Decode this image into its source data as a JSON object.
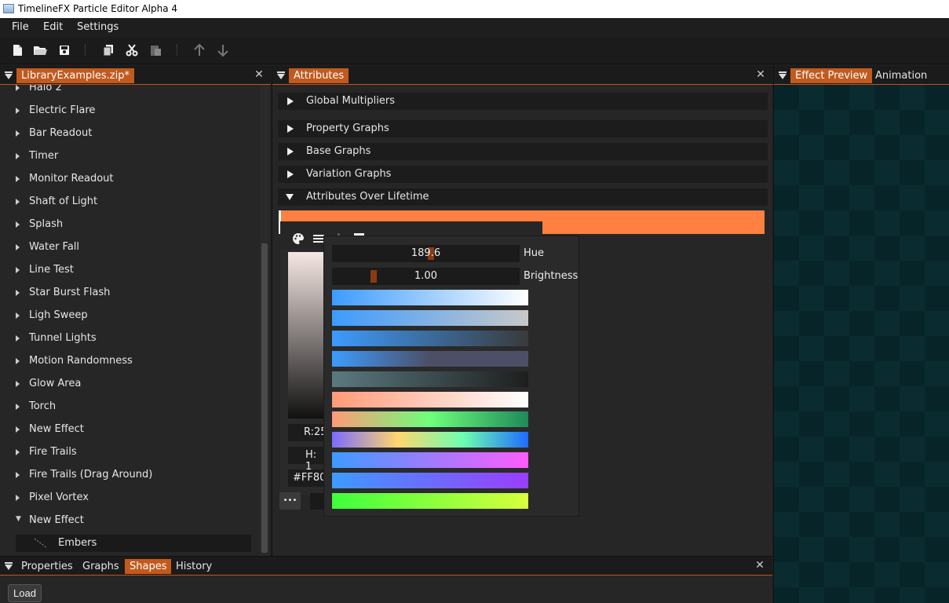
{
  "window": {
    "title": "TimelineFX Particle Editor Alpha 4"
  },
  "menu": {
    "items": [
      "File",
      "Edit",
      "Settings"
    ]
  },
  "library": {
    "tab": "LibraryExamples.zip*",
    "items": [
      {
        "label": "Halo 2",
        "expanded": false
      },
      {
        "label": "Electric Flare",
        "expanded": false
      },
      {
        "label": "Bar Readout",
        "expanded": false
      },
      {
        "label": "Timer",
        "expanded": false
      },
      {
        "label": "Monitor Readout",
        "expanded": false
      },
      {
        "label": "Shaft of Light",
        "expanded": false
      },
      {
        "label": "Splash",
        "expanded": false
      },
      {
        "label": "Water Fall",
        "expanded": false
      },
      {
        "label": "Line Test",
        "expanded": false
      },
      {
        "label": "Star Burst Flash",
        "expanded": false
      },
      {
        "label": "Ligh Sweep",
        "expanded": false
      },
      {
        "label": "Tunnel Lights",
        "expanded": false
      },
      {
        "label": "Motion Randomness",
        "expanded": false
      },
      {
        "label": "Glow Area",
        "expanded": false
      },
      {
        "label": "Torch",
        "expanded": false
      },
      {
        "label": "New Effect",
        "expanded": false
      },
      {
        "label": "Fire Trails",
        "expanded": false
      },
      {
        "label": "Fire Trails (Drag Around)",
        "expanded": false
      },
      {
        "label": "Pixel Vortex",
        "expanded": false
      },
      {
        "label": "New Effect",
        "expanded": true
      }
    ],
    "child": {
      "label": "Embers"
    }
  },
  "attributes": {
    "tab": "Attributes",
    "sections": [
      {
        "label": "Global Multipliers",
        "open": false
      },
      {
        "label": "Property Graphs",
        "open": false
      },
      {
        "label": "Base Graphs",
        "open": false
      },
      {
        "label": "Variation Graphs",
        "open": false
      },
      {
        "label": "Attributes Over Lifetime",
        "open": true
      }
    ],
    "color_bar": "#ff8040"
  },
  "picker": {
    "r_field": "R:25",
    "h_field": "H: 1",
    "hex_field": "#FF80",
    "more_label": "•••",
    "hue_value": "189.6",
    "hue_label": "Hue",
    "hue_fraction": 0.527,
    "brightness_value": "1.00",
    "brightness_label": "Brightness",
    "brightness_fraction": 0.21,
    "palettes": [
      [
        "#3d9bff",
        "#ffffff"
      ],
      [
        "#3d9bff",
        "#c8c8c8"
      ],
      [
        "#3d9bff",
        "#3a3a3a"
      ],
      [
        "#3d9bff",
        "#4c4f66",
        "#4c4f66"
      ],
      [
        "#5a7a80",
        "#1e1e1e"
      ],
      [
        "#ff9a78",
        "#ffffff"
      ],
      [
        "#ff9a78",
        "#6dff7a",
        "#1f8a5a"
      ],
      [
        "#7b6bff",
        "#ffd66e",
        "#6dffb0",
        "#1f6bff"
      ],
      [
        "#3d9bff",
        "#ff5cff"
      ],
      [
        "#3d9bff",
        "#9b3dff"
      ],
      [
        "#3dff3d",
        "#d8ff3d"
      ]
    ]
  },
  "preview": {
    "tabs": [
      "Effect Preview",
      "Animation"
    ]
  },
  "bottom": {
    "tabs": [
      "Properties",
      "Graphs",
      "Shapes",
      "History"
    ],
    "active_tab": "Shapes",
    "load_label": "Load"
  }
}
